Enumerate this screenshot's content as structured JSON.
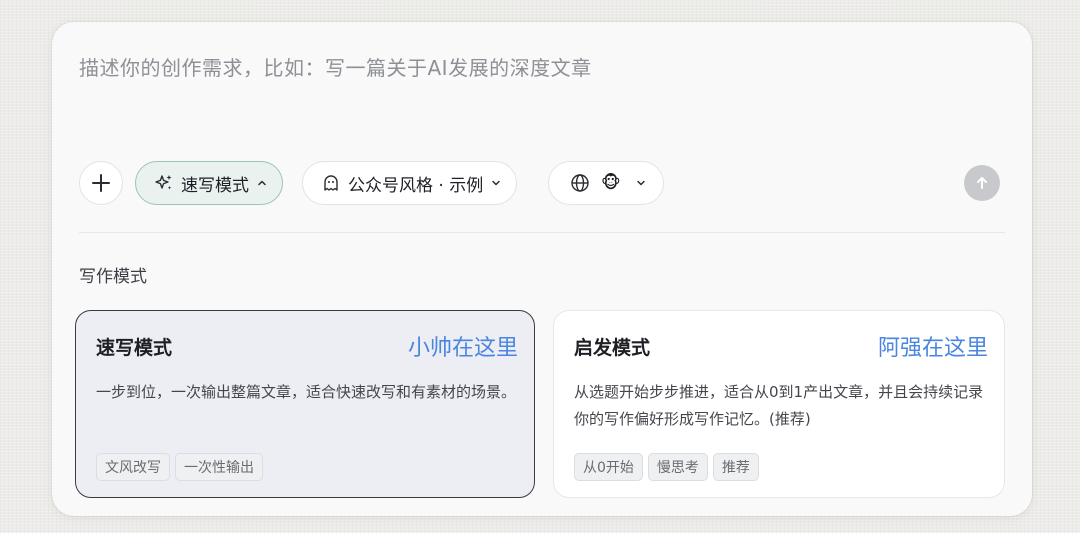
{
  "prompt": {
    "placeholder": "描述你的创作需求，比如：写一篇关于AI发展的深度文章"
  },
  "toolbar": {
    "add_icon": "plus-icon",
    "mode_pill": {
      "label": "速写模式",
      "icon": "sparkles-icon",
      "chevron": "chevron-up-icon"
    },
    "style_pill": {
      "label": "公众号风格 · 示例",
      "icon": "ghost-icon",
      "chevron": "chevron-down-icon"
    },
    "lang_pill": {
      "icon": "globe-icon",
      "emoji": "🐵",
      "chevron": "chevron-down-icon"
    },
    "send_icon": "arrow-up-icon"
  },
  "section": {
    "title": "写作模式"
  },
  "modes": [
    {
      "name": "速写模式",
      "hint": "小帅在这里",
      "desc": "一步到位，一次输出整篇文章，适合快速改写和有素材的场景。",
      "tags": [
        "文风改写",
        "一次性输出"
      ],
      "selected": true
    },
    {
      "name": "启发模式",
      "hint": "阿强在这里",
      "desc": "从选题开始步步推进，适合从0到1产出文章，并且会持续记录你的写作偏好形成写作记忆。(推荐)",
      "tags": [
        "从0开始",
        "慢思考",
        "推荐"
      ],
      "selected": false
    }
  ],
  "colors": {
    "accent_hint": "#4a86e0",
    "active_pill_bg": "#e9f2ef",
    "active_pill_border": "#9cc3b5",
    "send_disabled": "#c8c9cc"
  }
}
